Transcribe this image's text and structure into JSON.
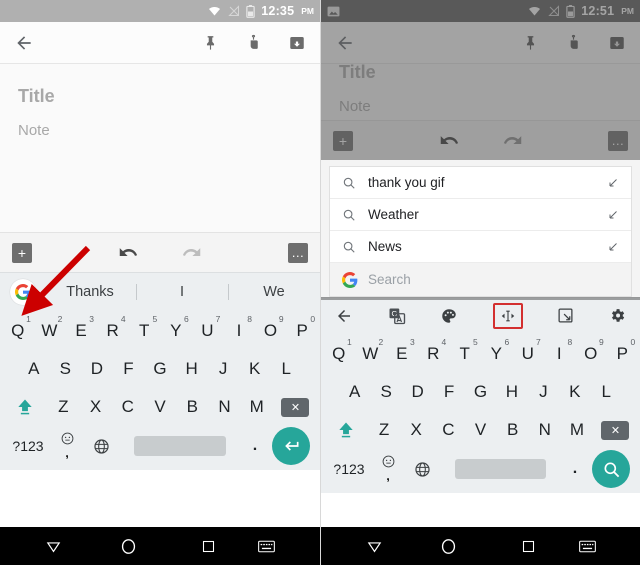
{
  "left": {
    "status_bar": {
      "time": "12:35",
      "ampm": "PM",
      "icons": [
        "wifi-icon",
        "signal-off-icon",
        "battery-icon"
      ],
      "bg_color": "#b0b0b0"
    },
    "app_bar": {
      "back": "back-arrow-icon",
      "actions": [
        "pin-icon",
        "reminder-icon",
        "archive-icon"
      ]
    },
    "note": {
      "title_placeholder": "Title",
      "note_placeholder": "Note"
    },
    "note_toolbar": {
      "add_label": "+",
      "undo": "undo-icon",
      "redo": "redo-icon",
      "more_label": "…"
    },
    "suggestion_strip": {
      "logo": "google-g-icon",
      "items": [
        "Thanks",
        "I",
        "We"
      ]
    },
    "keyboard": {
      "row1": [
        {
          "letter": "Q",
          "num": "1"
        },
        {
          "letter": "W",
          "num": "2"
        },
        {
          "letter": "E",
          "num": "3"
        },
        {
          "letter": "R",
          "num": "4"
        },
        {
          "letter": "T",
          "num": "5"
        },
        {
          "letter": "Y",
          "num": "6"
        },
        {
          "letter": "U",
          "num": "7"
        },
        {
          "letter": "I",
          "num": "8"
        },
        {
          "letter": "O",
          "num": "9"
        },
        {
          "letter": "P",
          "num": "0"
        }
      ],
      "row2": [
        "A",
        "S",
        "D",
        "F",
        "G",
        "H",
        "J",
        "K",
        "L"
      ],
      "row3": [
        "Z",
        "X",
        "C",
        "V",
        "B",
        "N",
        "M"
      ],
      "symbols_key": "?123",
      "comma_key": ",",
      "period_key": ".",
      "space_key": "",
      "action": "enter-icon",
      "accent_color": "#26a69a"
    },
    "nav_bar": [
      "back-triangle-icon",
      "home-circle-icon",
      "recents-square-icon",
      "keyboard-icon"
    ]
  },
  "right": {
    "status_bar": {
      "time": "12:51",
      "ampm": "PM",
      "left_icon": "image-notification-icon",
      "icons": [
        "wifi-icon",
        "signal-off-icon",
        "battery-icon"
      ],
      "bg_color": "#5a5a5a"
    },
    "app_bar": {
      "back": "back-arrow-icon",
      "actions": [
        "pin-icon",
        "reminder-icon",
        "archive-icon"
      ]
    },
    "note": {
      "title_placeholder": "Title",
      "note_placeholder": "Note"
    },
    "note_toolbar": {
      "add_label": "+",
      "undo": "undo-icon",
      "redo": "redo-icon",
      "more_label": "…"
    },
    "search": {
      "suggestions": [
        "thank you gif",
        "Weather",
        "News"
      ],
      "input_placeholder": "Search",
      "logo": "google-g-icon"
    },
    "kb_toolbar": {
      "items": [
        {
          "name": "back-arrow-icon",
          "selected": false
        },
        {
          "name": "translate-icon",
          "selected": false
        },
        {
          "name": "theme-palette-icon",
          "selected": false
        },
        {
          "name": "text-cursor-move-icon",
          "selected": true
        },
        {
          "name": "one-handed-mode-icon",
          "selected": false
        },
        {
          "name": "settings-gear-icon",
          "selected": false
        }
      ],
      "highlight_color": "#d32f2f"
    },
    "keyboard": {
      "row1": [
        {
          "letter": "Q",
          "num": "1"
        },
        {
          "letter": "W",
          "num": "2"
        },
        {
          "letter": "E",
          "num": "3"
        },
        {
          "letter": "R",
          "num": "4"
        },
        {
          "letter": "T",
          "num": "5"
        },
        {
          "letter": "Y",
          "num": "6"
        },
        {
          "letter": "U",
          "num": "7"
        },
        {
          "letter": "I",
          "num": "8"
        },
        {
          "letter": "O",
          "num": "9"
        },
        {
          "letter": "P",
          "num": "0"
        }
      ],
      "row2": [
        "A",
        "S",
        "D",
        "F",
        "G",
        "H",
        "J",
        "K",
        "L"
      ],
      "row3": [
        "Z",
        "X",
        "C",
        "V",
        "B",
        "N",
        "M"
      ],
      "symbols_key": "?123",
      "comma_key": ",",
      "period_key": ".",
      "space_key": "",
      "action": "search-icon",
      "accent_color": "#26a69a"
    },
    "nav_bar": [
      "back-triangle-icon",
      "home-circle-icon",
      "recents-square-icon",
      "keyboard-icon"
    ]
  },
  "annotation": {
    "arrow_color": "#cc0000",
    "target": "google-g-icon"
  }
}
